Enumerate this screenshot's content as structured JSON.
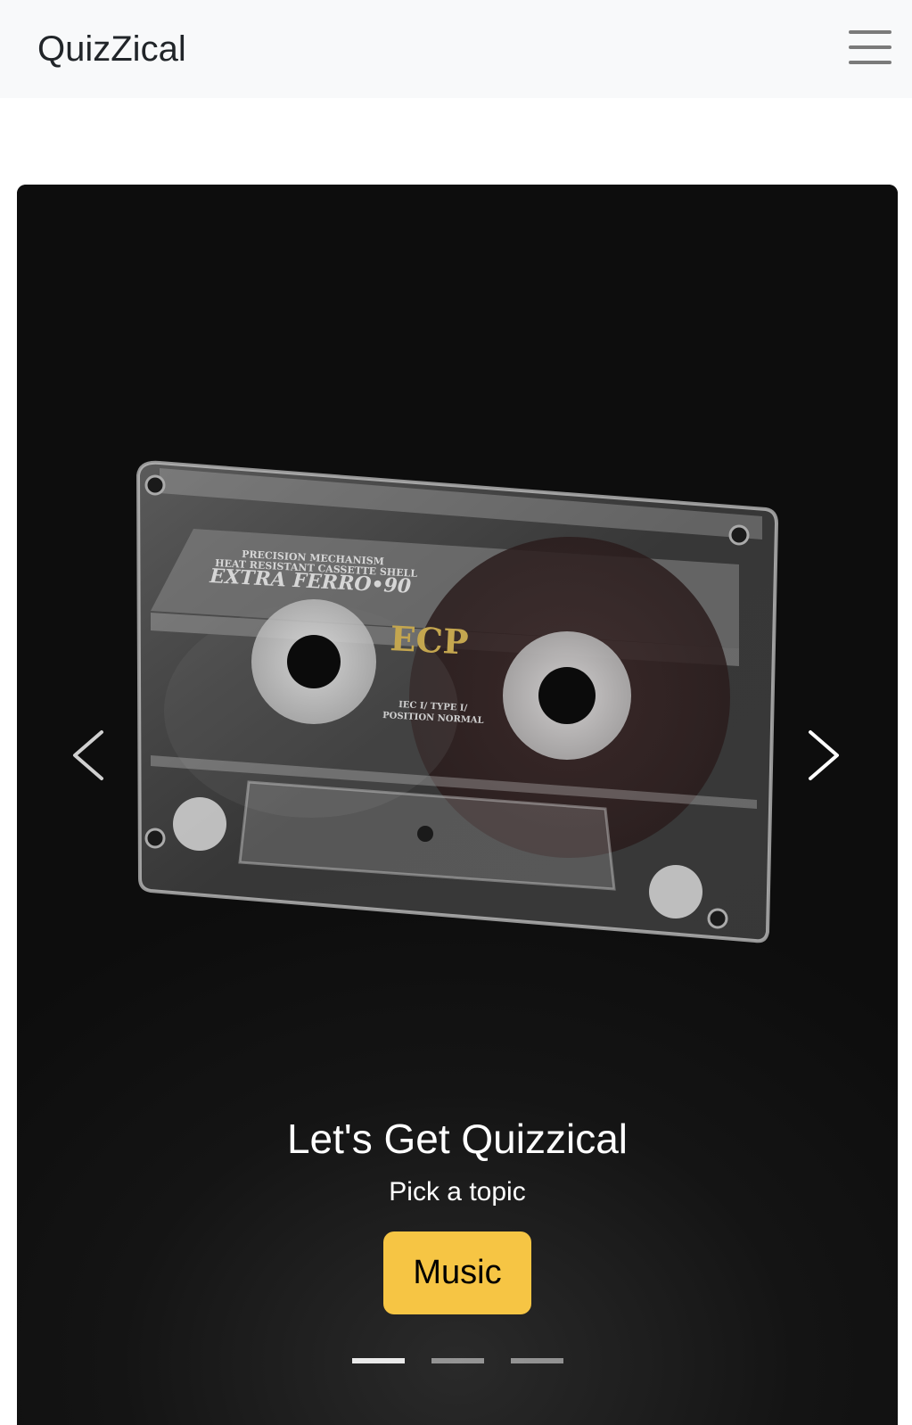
{
  "navbar": {
    "brand": "QuizZical",
    "toggler_icon": "hamburger-menu-icon"
  },
  "carousel": {
    "image_subject": "cassette-tape-image",
    "cassette_label": {
      "line1": "PRECISION MECHANISM",
      "line2": "HEAT RESISTANT CASSETTE SHELL",
      "line3": "EXTRA FERRO•90",
      "brand": "ECP",
      "type_line1": "IEC I/ TYPE I/",
      "type_line2": "POSITION NORMAL"
    },
    "prev_icon": "chevron-left-icon",
    "next_icon": "chevron-right-icon",
    "caption": {
      "title": "Let's Get Quizzical",
      "subtitle": "Pick a topic",
      "button_label": "Music"
    },
    "indicators_count": 3,
    "active_indicator": 1
  },
  "colors": {
    "navbar_bg": "#f8f9fa",
    "accent_button": "#f6c544",
    "slide_bg": "#0f0f0f"
  }
}
